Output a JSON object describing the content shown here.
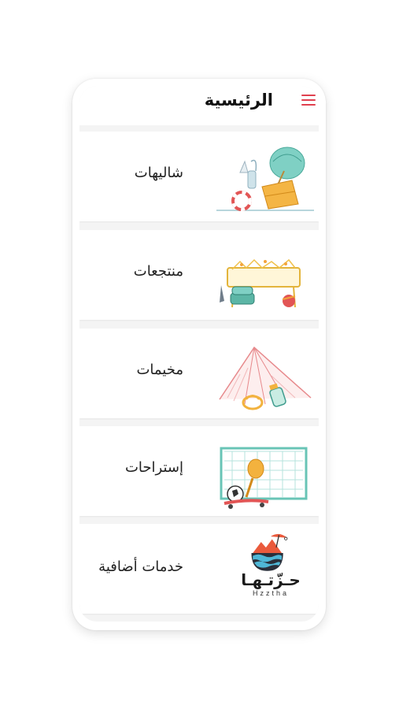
{
  "header": {
    "title": "الرئيسية",
    "menu_icon": "hamburger-icon"
  },
  "categories": [
    {
      "label": "شاليهات",
      "icon": "chalet-beach-illustration"
    },
    {
      "label": "منتجعات",
      "icon": "resort-pool-illustration"
    },
    {
      "label": "مخيمات",
      "icon": "camp-tent-illustration"
    },
    {
      "label": "إستراحات",
      "icon": "rest-house-sports-illustration"
    },
    {
      "label": "خدمات أضافية",
      "icon": "hzztha-logo"
    }
  ],
  "logo": {
    "arabic": "حـزّتـهـا",
    "latin": "Hzztha"
  },
  "colors": {
    "accent": "#e0404f",
    "background": "#f4f4f4",
    "card": "#ffffff"
  }
}
